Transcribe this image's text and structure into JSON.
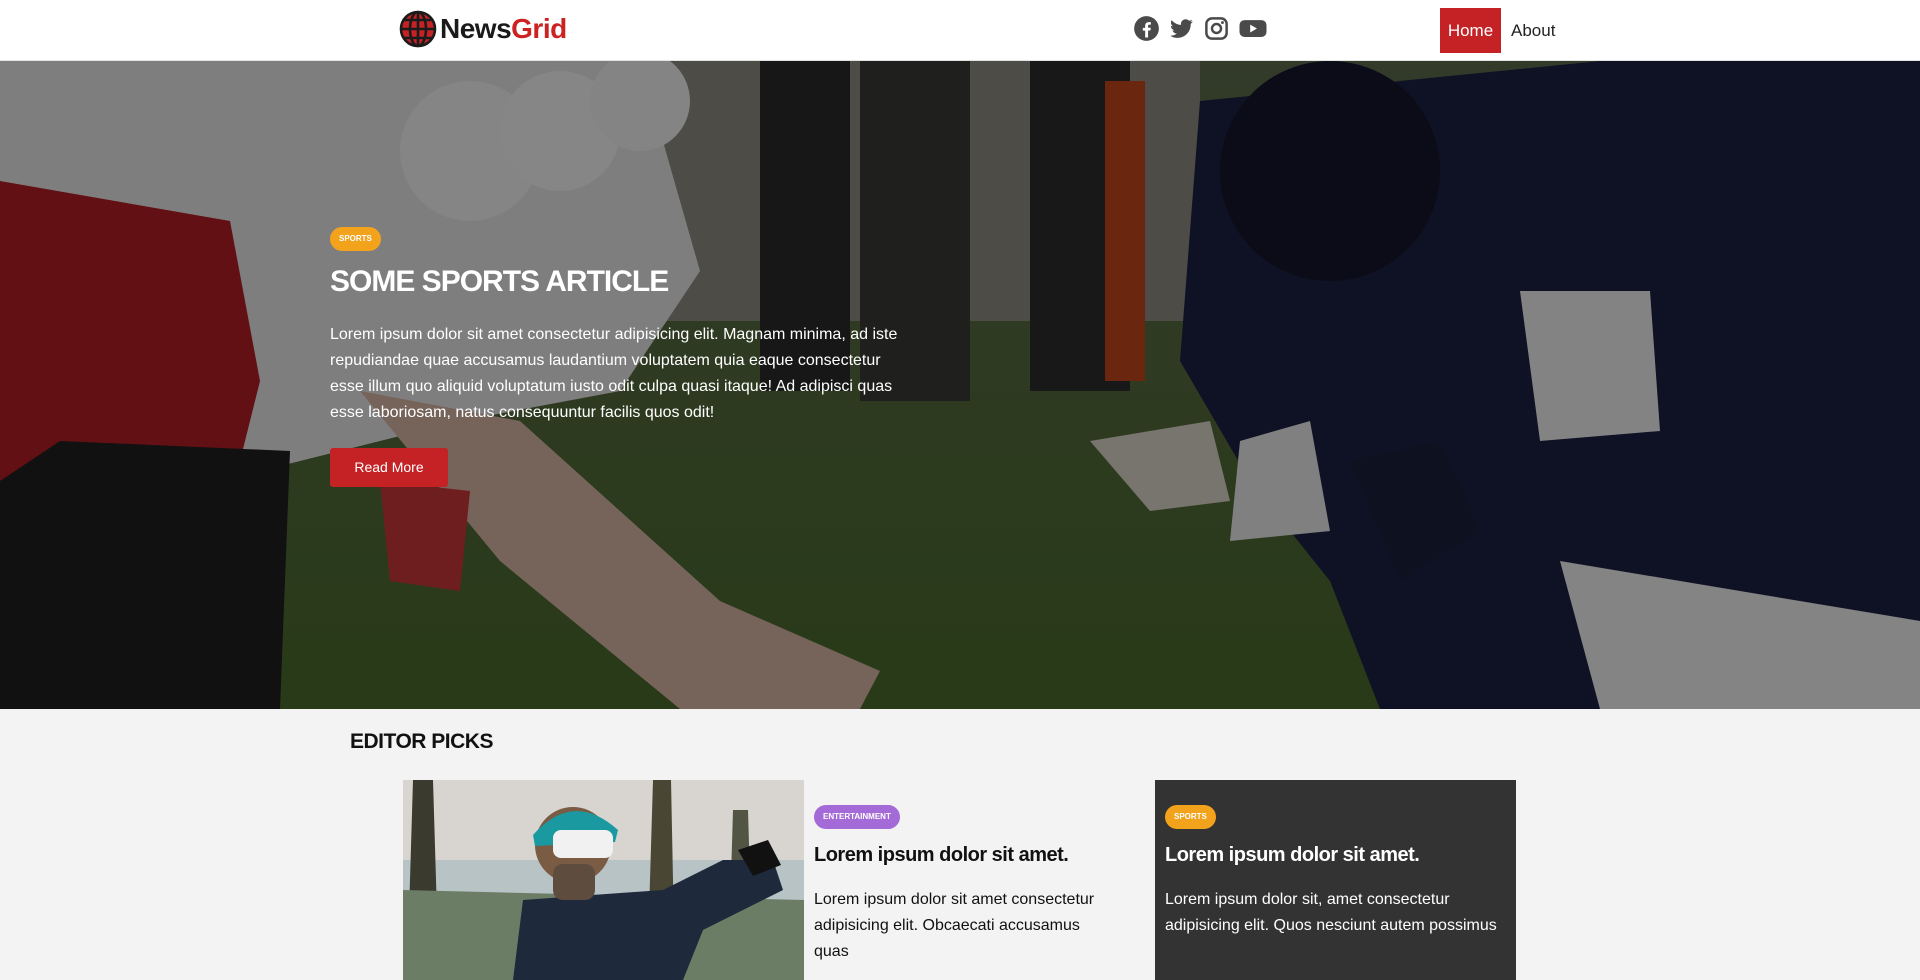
{
  "brand": {
    "name_part1": "News",
    "name_part2": "Grid"
  },
  "social": [
    "facebook-icon",
    "twitter-icon",
    "instagram-icon",
    "youtube-icon"
  ],
  "nav": {
    "home": "Home",
    "about": "About"
  },
  "hero": {
    "badge": "SPORTS",
    "title": "SOME SPORTS ARTICLE",
    "text": "Lorem ipsum dolor sit amet consectetur adipisicing elit. Magnam minima, ad iste repudiandae quae accusamus laudantium voluptatem quia eaque consectetur esse illum quo aliquid voluptatum iusto odit culpa quasi itaque! Ad adipisci quas esse laboriosam, natus consequuntur facilis quos odit!",
    "button": "Read More"
  },
  "editor_picks": {
    "heading": "EDITOR PICKS",
    "cards": [
      {
        "badge": "ENTERTAINMENT",
        "title": "Lorem ipsum dolor sit amet.",
        "text": "Lorem ipsum dolor sit amet consectetur adipisicing elit. Obcaecati accusamus quas"
      },
      {
        "badge": "SPORTS",
        "title": "Lorem ipsum dolor sit amet.",
        "text": "Lorem ipsum dolor sit, amet consectetur adipisicing elit. Quos nesciunt autem possimus"
      }
    ]
  },
  "colors": {
    "accent": "#c52226",
    "sports_badge": "#f3a21c",
    "entertainment_badge": "#a46ad7",
    "dark_card": "#333333"
  }
}
